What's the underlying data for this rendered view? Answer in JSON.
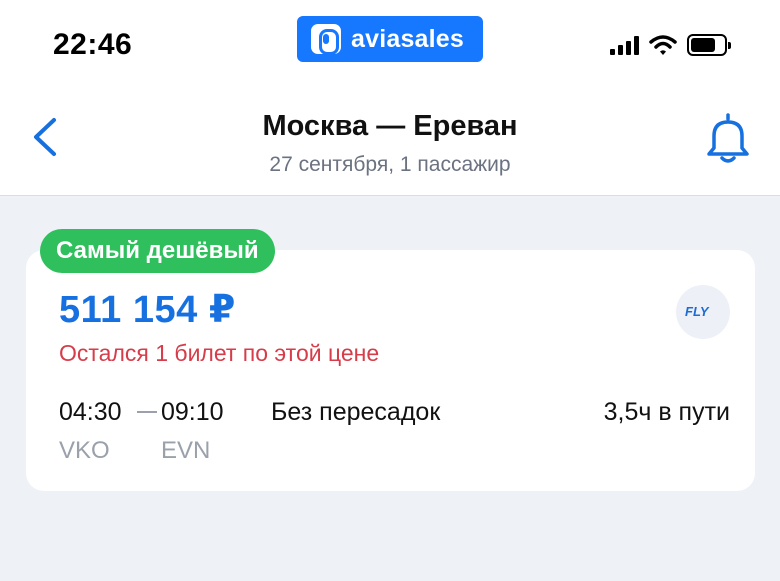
{
  "status_bar": {
    "time": "22:46",
    "app_name": "aviasales",
    "icons": [
      "signal-icon",
      "wifi-icon",
      "battery-icon"
    ]
  },
  "header": {
    "title": "Москва — Ереван",
    "subtitle": "27 сентября, 1 пассажир",
    "back_icon": "chevron-left-icon",
    "bell_icon": "bell-icon"
  },
  "ticket": {
    "badge": "Самый дешёвый",
    "price": "511 154 ₽",
    "warning": "Остался 1 билет по этой цене",
    "airline_logo_text": "FLY",
    "departure_time": "04:30",
    "arrival_time": "09:10",
    "stops": "Без пересадок",
    "duration": "3,5ч в пути",
    "departure_airport": "VKO",
    "arrival_airport": "EVN"
  },
  "colors": {
    "accent": "#1670e0",
    "badge": "#2fbf5d",
    "warning": "#d63c49",
    "background": "#eef1f6"
  }
}
